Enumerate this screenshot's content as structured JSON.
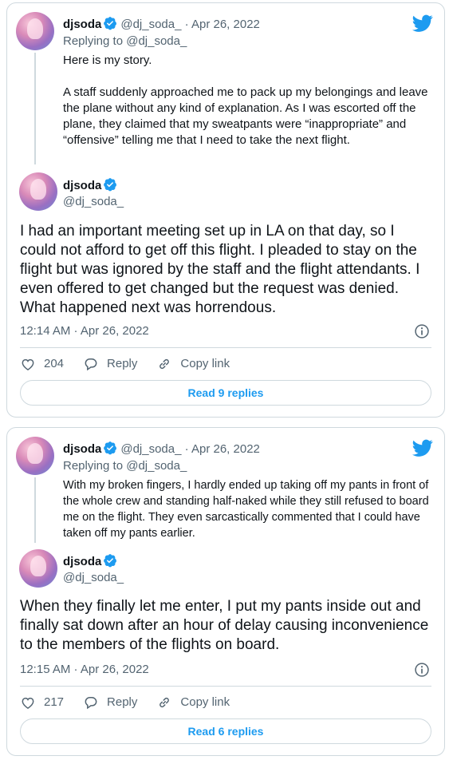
{
  "colors": {
    "accent": "#1d9bf0",
    "muted": "#536471",
    "border": "#cfd9de",
    "text": "#0f1419"
  },
  "tweets": [
    {
      "parent": {
        "name": "djsoda",
        "handle": "@dj_soda_",
        "date": "· Apr 26, 2022",
        "replying_prefix": "Replying to",
        "replying_to": "@dj_soda_",
        "paragraphs": [
          "Here is my story.",
          "A staff suddenly approached me to pack up my belongings and leave the plane without any kind of explanation. As I was escorted off the plane, they claimed that my sweatpants were “inappropriate” and “offensive” telling me that I need to take the next flight."
        ]
      },
      "main": {
        "name": "djsoda",
        "handle": "@dj_soda_",
        "text": "I had an important meeting set up in LA on that day, so I could not afford to get off this flight. I pleaded to stay on the flight but was ignored by the staff and the flight attendants. I even offered to get changed but the request was denied. What happened next was horrendous.",
        "timestamp": "12:14 AM · Apr 26, 2022",
        "likes": "204",
        "reply_label": "Reply",
        "copy_label": "Copy link",
        "read_replies": "Read 9 replies"
      }
    },
    {
      "parent": {
        "name": "djsoda",
        "handle": "@dj_soda_",
        "date": "· Apr 26, 2022",
        "replying_prefix": "Replying to",
        "replying_to": "@dj_soda_",
        "paragraphs": [
          "With my broken fingers, I hardly ended up taking off my pants in front of the whole crew and standing half-naked while they still refused to board me on the flight. They even sarcastically commented that I could have taken off my pants earlier."
        ]
      },
      "main": {
        "name": "djsoda",
        "handle": "@dj_soda_",
        "text": "When they finally let me enter, I put my pants inside out and finally sat down after an hour of delay causing inconvenience to the members of the flights on board.",
        "timestamp": "12:15 AM · Apr 26, 2022",
        "likes": "217",
        "reply_label": "Reply",
        "copy_label": "Copy link",
        "read_replies": "Read 6 replies"
      }
    }
  ]
}
